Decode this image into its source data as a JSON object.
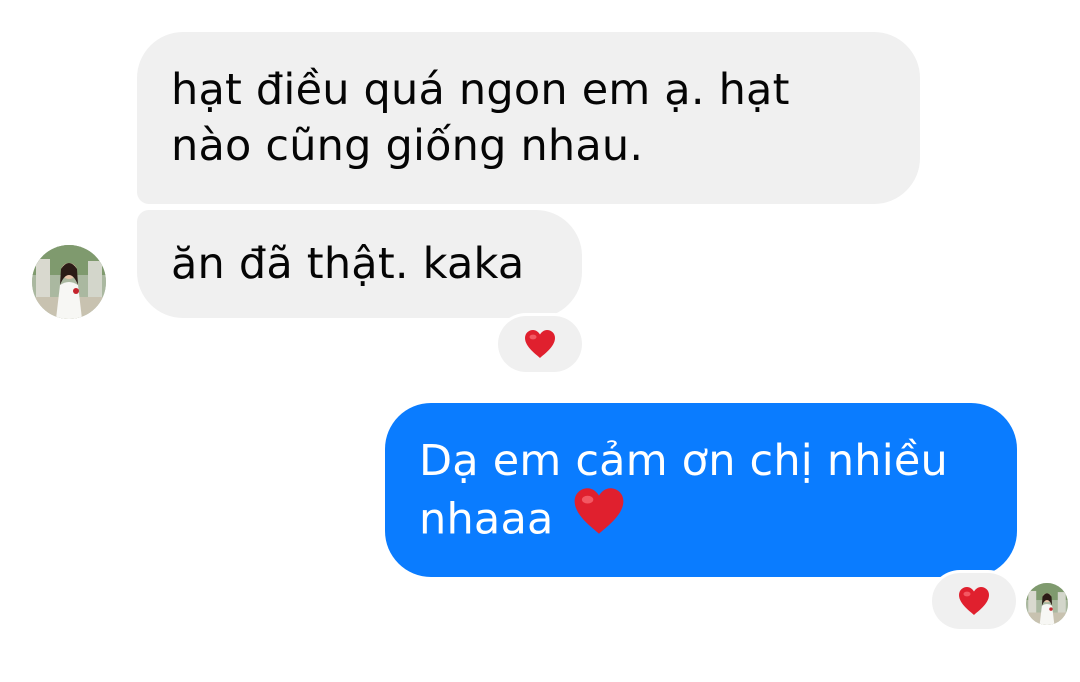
{
  "messages": [
    {
      "direction": "incoming",
      "lines": [
        "hạt điều quá ngon em ạ. hạt",
        "nào cũng giống nhau."
      ]
    },
    {
      "direction": "incoming",
      "lines": [
        "ăn đã thật. kaka"
      ],
      "reaction": "heart-icon"
    },
    {
      "direction": "outgoing",
      "lines": [
        "Dạ em cảm ơn chị nhiều",
        "nhaaa"
      ],
      "trailing_emoji": "heart-icon",
      "reaction": "heart-icon"
    }
  ],
  "colors": {
    "incoming_bubble": "#f0f0f0",
    "outgoing_bubble": "#0a7cff",
    "incoming_text": "#050505",
    "outgoing_text": "#ffffff",
    "heart": "#e0202e"
  }
}
